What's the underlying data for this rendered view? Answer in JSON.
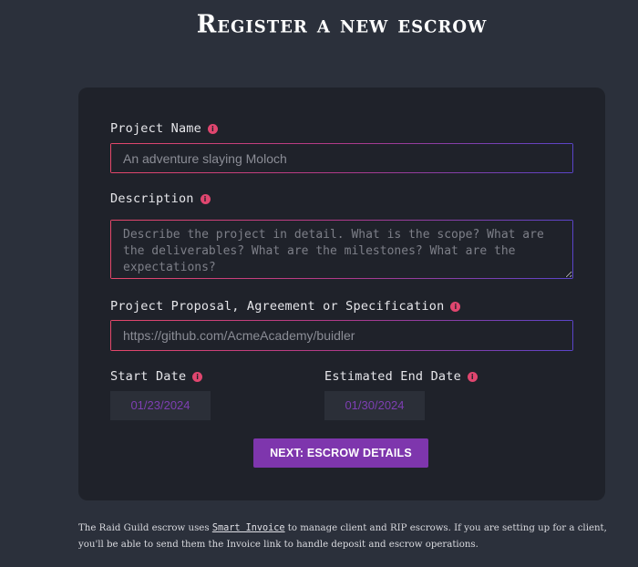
{
  "page": {
    "title": "Register a new escrow"
  },
  "form": {
    "project_name": {
      "label": "Project Name",
      "placeholder": "An adventure slaying Moloch"
    },
    "description": {
      "label": "Description",
      "placeholder": "Describe the project in detail. What is the scope? What are the deliverables? What are the milestones? What are the expectations?"
    },
    "proposal": {
      "label": "Project Proposal, Agreement or Specification",
      "placeholder": "https://github.com/AcmeAcademy/buidler"
    },
    "start_date": {
      "label": "Start Date",
      "value": "01/23/2024"
    },
    "end_date": {
      "label": "Estimated End Date",
      "value": "01/30/2024"
    },
    "next_button_label": "NEXT: ESCROW DETAILS",
    "info_icon_glyph": "i"
  },
  "footer": {
    "text_before": "The Raid Guild escrow uses ",
    "link_text": "Smart Invoice",
    "text_after": " to manage client and RIP escrows. If you are setting up for a client, you'll be able to send them the Invoice link to handle deposit and escrow operations."
  },
  "colors": {
    "background": "#2b303b",
    "card": "#1f222a",
    "accent": "#7e36ad",
    "info_icon": "#e0466f",
    "gradient_start": "#e5476a",
    "gradient_end": "#5a44c9"
  }
}
